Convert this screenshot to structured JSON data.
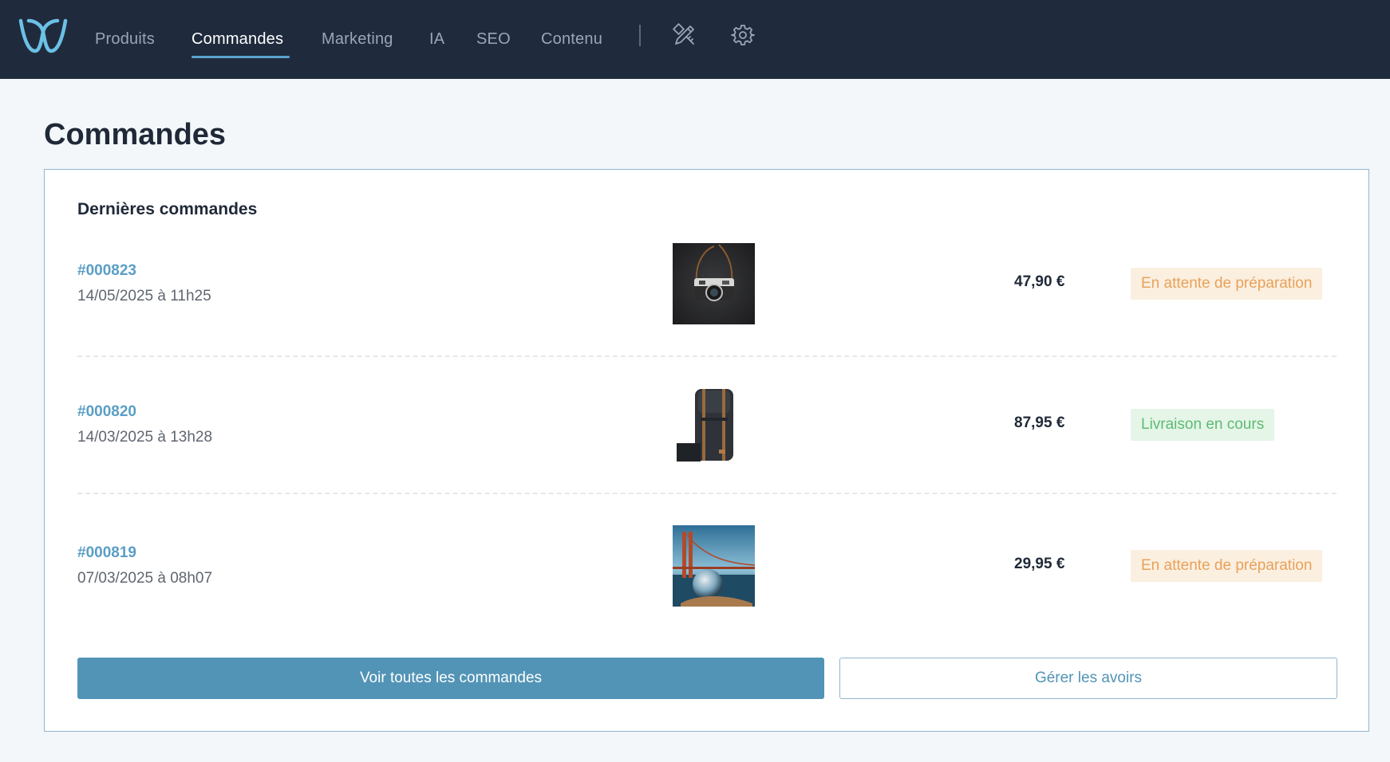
{
  "nav": {
    "items": [
      {
        "label": "Produits"
      },
      {
        "label": "Commandes",
        "active": true
      },
      {
        "label": "Marketing"
      },
      {
        "label": "IA"
      },
      {
        "label": "SEO"
      },
      {
        "label": "Contenu"
      }
    ],
    "icons": [
      "design-tools-icon",
      "gear-icon"
    ],
    "logo": "w-logo-icon"
  },
  "page": {
    "title": "Commandes"
  },
  "orders_card": {
    "title": "Dernières commandes",
    "orders": [
      {
        "id": "#000823",
        "date": "14/05/2025 à 11h25",
        "image": "camera",
        "price": "47,90 €",
        "status": "En attente de préparation",
        "status_type": "pending"
      },
      {
        "id": "#000820",
        "date": "14/03/2025 à 13h28",
        "image": "backpack",
        "price": "87,95 €",
        "status": "Livraison en cours",
        "status_type": "shipping"
      },
      {
        "id": "#000819",
        "date": "07/03/2025 à 08h07",
        "image": "bridge-crystal-ball",
        "price": "29,95 €",
        "status": "En attente de préparation",
        "status_type": "pending"
      }
    ],
    "primary_button": "Voir toutes les commandes",
    "secondary_button": "Gérer les avoirs"
  },
  "colors": {
    "navbar": "#1f2b3d",
    "accent": "#5294b6",
    "pending_bg": "#fbefe0",
    "pending_text": "#e8a25a",
    "shipping_bg": "#e5f5e8",
    "shipping_text": "#5dbb72"
  }
}
